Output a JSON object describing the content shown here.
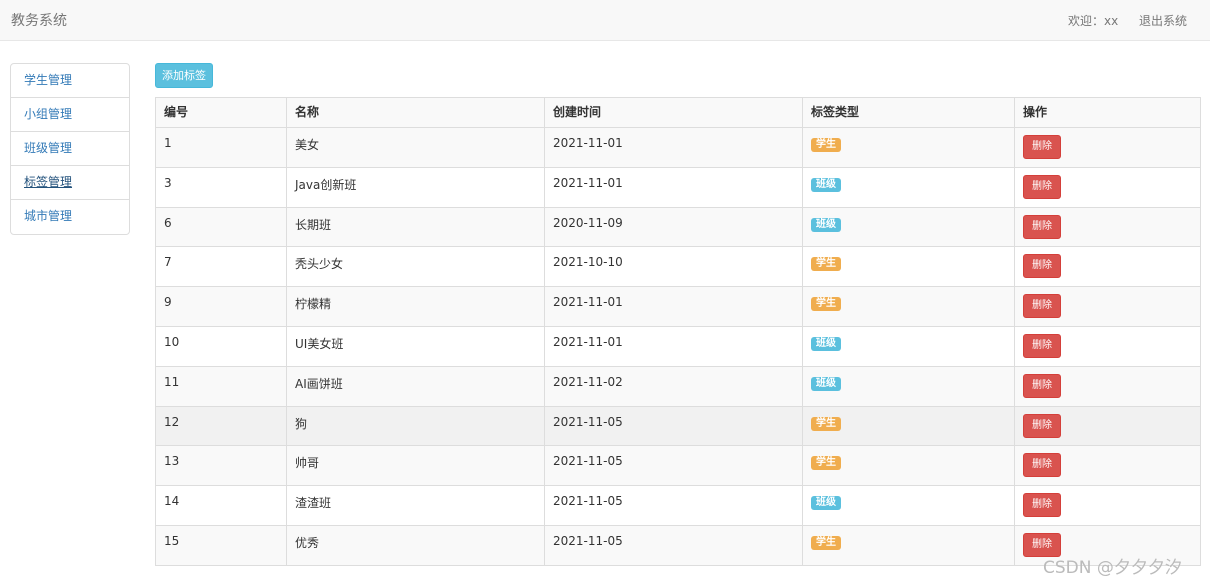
{
  "navbar": {
    "brand": "教务系统",
    "welcome": "欢迎：xx",
    "logout": "退出系统"
  },
  "sidebar": {
    "items": [
      {
        "label": "学生管理"
      },
      {
        "label": "小组管理"
      },
      {
        "label": "班级管理"
      },
      {
        "label": "标签管理",
        "active": true
      },
      {
        "label": "城市管理"
      }
    ]
  },
  "toolbar": {
    "add_label": "添加标签"
  },
  "table": {
    "headers": [
      "编号",
      "名称",
      "创建时间",
      "标签类型",
      "操作"
    ],
    "delete_label": "删除",
    "tag_colors": {
      "学生": "#f0ad4e",
      "班级": "#5bc0de"
    },
    "rows": [
      {
        "id": "1",
        "name": "美女",
        "created": "2021-11-01",
        "type": "学生"
      },
      {
        "id": "3",
        "name": "Java创新班",
        "created": "2021-11-01",
        "type": "班级"
      },
      {
        "id": "6",
        "name": "长期班",
        "created": "2020-11-09",
        "type": "班级"
      },
      {
        "id": "7",
        "name": "秃头少女",
        "created": "2021-10-10",
        "type": "学生"
      },
      {
        "id": "9",
        "name": "柠檬精",
        "created": "2021-11-01",
        "type": "学生"
      },
      {
        "id": "10",
        "name": "UI美女班",
        "created": "2021-11-01",
        "type": "班级"
      },
      {
        "id": "11",
        "name": "AI画饼班",
        "created": "2021-11-02",
        "type": "班级"
      },
      {
        "id": "12",
        "name": "狗",
        "created": "2021-11-05",
        "type": "学生"
      },
      {
        "id": "13",
        "name": "帅哥",
        "created": "2021-11-05",
        "type": "学生"
      },
      {
        "id": "14",
        "name": "渣渣班",
        "created": "2021-11-05",
        "type": "班级"
      },
      {
        "id": "15",
        "name": "优秀",
        "created": "2021-11-05",
        "type": "学生"
      }
    ]
  },
  "watermark": "CSDN @夕夕夕汐"
}
